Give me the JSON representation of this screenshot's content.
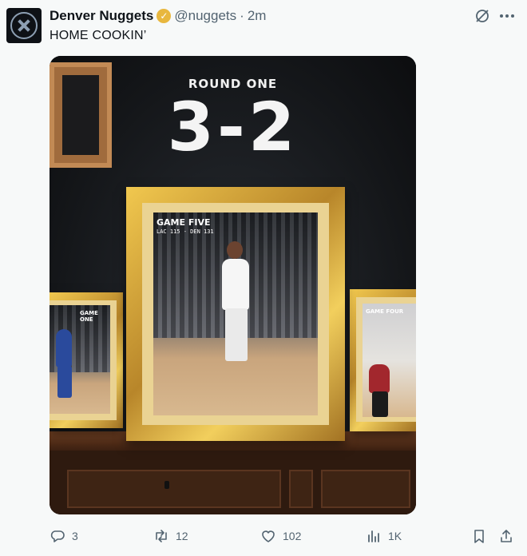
{
  "tweet": {
    "display_name": "Denver Nuggets",
    "handle": "@nuggets",
    "separator": "·",
    "time": "2m",
    "text": "HOME COOKIN’",
    "verified_icon": "✓"
  },
  "media": {
    "round_label": "ROUND ONE",
    "score": "3-2",
    "center_frame": {
      "game_label": "GAME FIVE",
      "score_line": "LAC 115 - DEN 131"
    },
    "left_frame": {
      "game_label": "GAME ONE"
    },
    "right_frame": {
      "game_label": "GAME FOUR"
    }
  },
  "actions": {
    "replies": "3",
    "retweets": "12",
    "likes": "102",
    "views": "1K"
  },
  "icons": {
    "avatar": "nuggets-logo-icon",
    "verified": "verified-badge-icon",
    "grok": "grok-icon",
    "more": "more-icon",
    "reply": "reply-icon",
    "retweet": "retweet-icon",
    "like": "heart-icon",
    "views": "views-icon",
    "bookmark": "bookmark-icon",
    "share": "share-icon"
  },
  "colors": {
    "background": "#f7f9f9",
    "text": "#0f1419",
    "secondary": "#536471",
    "verified_gold": "#e8b73e"
  }
}
